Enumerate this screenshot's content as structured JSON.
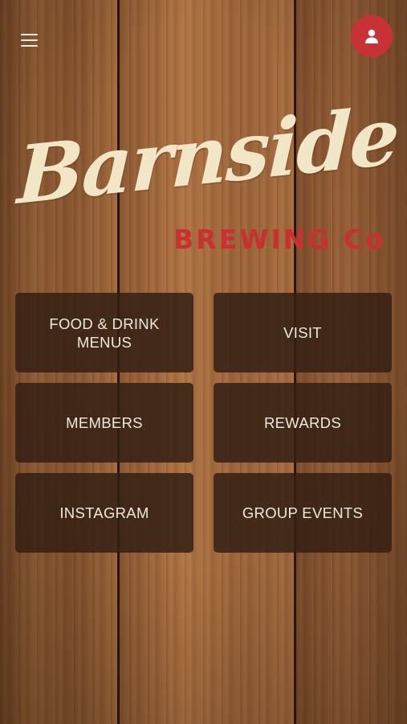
{
  "header": {
    "menu_icon": "hamburger-menu-icon",
    "profile_icon": "user-icon",
    "profile_color": "#c73236"
  },
  "logo": {
    "script_text": "Barnside",
    "sub_text": "BREWING Co",
    "script_color": "#f1e6c6",
    "sub_color": "#c9302f"
  },
  "tiles": [
    {
      "label": "FOOD & DRINK\nMENUS"
    },
    {
      "label": "VISIT"
    },
    {
      "label": "MEMBERS"
    },
    {
      "label": "REWARDS"
    },
    {
      "label": "INSTAGRAM"
    },
    {
      "label": "GROUP EVENTS"
    }
  ]
}
